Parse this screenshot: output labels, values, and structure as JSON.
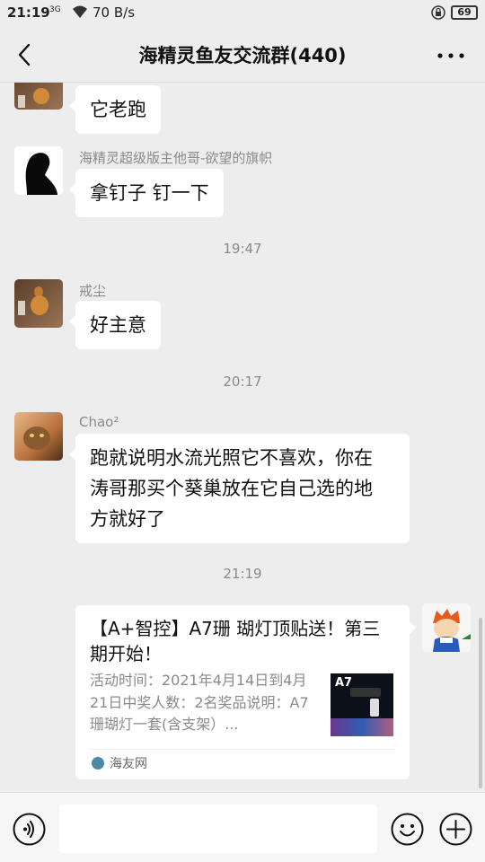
{
  "status_bar": {
    "time": "21:19",
    "signal": "3G",
    "speed": "70 B/s",
    "battery": "69"
  },
  "header": {
    "title": "海精灵鱼友交流群(440)"
  },
  "messages": [
    {
      "sender": "",
      "text": "它老跑",
      "avatar": "gourd-avatar"
    },
    {
      "sender": "海精灵超级版主他哥-欲望的旗帜",
      "text": "拿钉子 钉一下",
      "avatar": "silhouette-avatar"
    },
    {
      "sender": "戒尘",
      "text": "好主意",
      "avatar": "gourd-avatar"
    },
    {
      "sender": "Chao²",
      "text_lines": [
        "跑就说明水流光照它不喜欢，你在",
        "涛哥那买个葵巢放在它自己选的地",
        "方就好了"
      ],
      "avatar": "cat-avatar"
    }
  ],
  "time_dividers": [
    "19:47",
    "20:17",
    "21:19"
  ],
  "link_card": {
    "title": "【A+智控】A7珊 瑚灯顶贴送！第三期开始！",
    "description": "活动时间：2021年4月14日到4月21日中奖人数：2名奖品说明：A7珊瑚灯一套(含支架）...",
    "thumb_label": "A7",
    "source": "海友网"
  },
  "input": {
    "placeholder": ""
  },
  "colors": {
    "background": "#ededed",
    "bubble": "#ffffff",
    "meta_text": "#8a8a8a"
  }
}
